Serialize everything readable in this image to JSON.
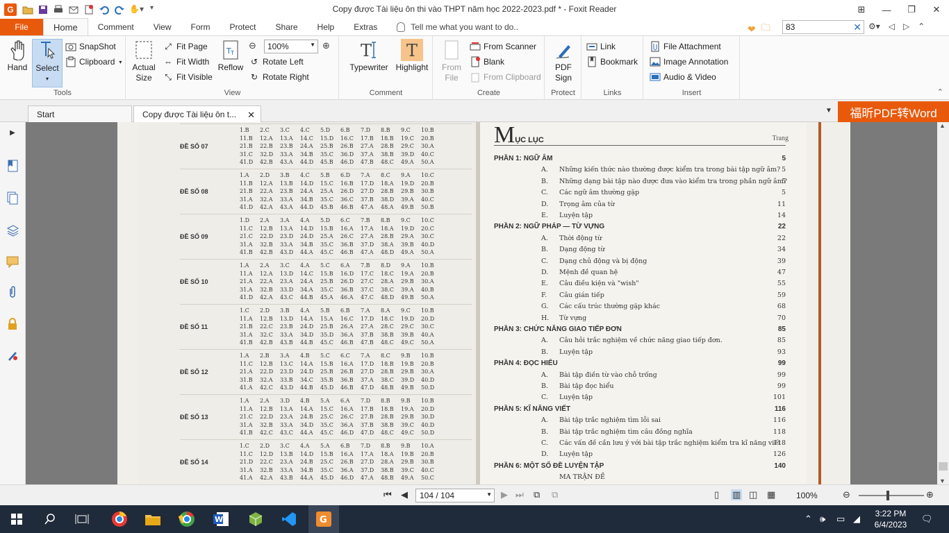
{
  "window": {
    "title": "Copy được Tài liệu ôn thi vào THPT năm học 2022-2023.pdf * - Foxit Reader",
    "app_logo": "G"
  },
  "ribbon_tabs": [
    "File",
    "Home",
    "Comment",
    "View",
    "Form",
    "Protect",
    "Share",
    "Help",
    "Extras"
  ],
  "active_tab": "Home",
  "tell_me": "Tell me what you want to do..",
  "search": {
    "value": "83"
  },
  "tools_group": {
    "label": "Tools",
    "hand": "Hand",
    "select": "Select",
    "snapshot": "SnapShot",
    "clipboard": "Clipboard"
  },
  "view_group": {
    "label": "View",
    "actual_size_1": "Actual",
    "actual_size_2": "Size",
    "fit_page": "Fit Page",
    "fit_width": "Fit Width",
    "fit_visible": "Fit Visible",
    "reflow": "Reflow",
    "zoom": "100%",
    "rotate_left": "Rotate Left",
    "rotate_right": "Rotate Right"
  },
  "comment_group": {
    "label": "Comment",
    "typewriter": "Typewriter",
    "highlight": "Highlight"
  },
  "create_group": {
    "label": "Create",
    "from_file_1": "From",
    "from_file_2": "File",
    "from_scanner": "From Scanner",
    "blank": "Blank",
    "from_clipboard": "From Clipboard"
  },
  "protect_group": {
    "label": "Protect",
    "pdf_sign_1": "PDF",
    "pdf_sign_2": "Sign"
  },
  "links_group": {
    "label": "Links",
    "link": "Link",
    "bookmark": "Bookmark"
  },
  "insert_group": {
    "label": "Insert",
    "file_attachment": "File Attachment",
    "image_annotation": "Image Annotation",
    "audio_video": "Audio & Video"
  },
  "doc_tabs": {
    "start": "Start",
    "current": "Copy được Tài liệu ôn t..."
  },
  "promo": "福昕PDF转Word",
  "answer_key": [
    {
      "label": "ĐỀ SỐ 07",
      "cols": [
        [
          "1.B",
          "11.B",
          "21.B",
          "31.C",
          "41.D"
        ],
        [
          "2.C",
          "12.A",
          "22.B",
          "32.D",
          "42.B"
        ],
        [
          "3.C",
          "13.A",
          "23.B",
          "33.A",
          "43.A"
        ],
        [
          "4.C",
          "14.C",
          "24.A",
          "34.B",
          "44.D"
        ],
        [
          "5.D",
          "15.D",
          "25.B",
          "35.C",
          "45.B"
        ],
        [
          "6.B",
          "16.C",
          "26.B",
          "36.D",
          "46.D"
        ],
        [
          "7.D",
          "17.B",
          "27.A",
          "37.A",
          "47.B"
        ],
        [
          "8.B",
          "18.B",
          "28.B",
          "38.B",
          "48.C"
        ],
        [
          "9.C",
          "19.C",
          "29.C",
          "39.D",
          "49.A"
        ],
        [
          "10.B",
          "20.B",
          "30.A",
          "40.C",
          "50.A"
        ]
      ]
    },
    {
      "label": "ĐỀ SỐ 08",
      "cols": [
        [
          "1.A",
          "11.B",
          "21.B",
          "31.A",
          "41.D"
        ],
        [
          "2.D",
          "12.A",
          "22.A",
          "32.A",
          "42.A"
        ],
        [
          "3.B",
          "13.B",
          "23.B",
          "33.A",
          "43.A"
        ],
        [
          "4.C",
          "14.D",
          "24.A",
          "34.B",
          "44.D"
        ],
        [
          "5.B",
          "15.C",
          "25.A",
          "35.C",
          "45.B"
        ],
        [
          "6.D",
          "16.B",
          "26.D",
          "36.C",
          "46.B"
        ],
        [
          "7.A",
          "17.D",
          "27.D",
          "37.B",
          "47.A"
        ],
        [
          "8.C",
          "18.A",
          "28.B",
          "38.D",
          "48.A"
        ],
        [
          "9.A",
          "19.D",
          "29.B",
          "39.A",
          "49.B"
        ],
        [
          "10.C",
          "20.B",
          "30.B",
          "40.C",
          "50.B"
        ]
      ]
    },
    {
      "label": "ĐỀ SỐ 09",
      "cols": [
        [
          "1.D",
          "11.C",
          "21.C",
          "31.A",
          "41.B"
        ],
        [
          "2.A",
          "12.B",
          "22.D",
          "32.B",
          "42.B"
        ],
        [
          "3.A",
          "13.A",
          "23.D",
          "33.A",
          "43.D"
        ],
        [
          "4.A",
          "14.D",
          "24.D",
          "34.B",
          "44.A"
        ],
        [
          "5.D",
          "15.B",
          "25.A",
          "35.C",
          "45.C"
        ],
        [
          "6.C",
          "16.A",
          "26.C",
          "36.B",
          "46.B"
        ],
        [
          "7.B",
          "17.A",
          "27.A",
          "37.D",
          "47.A"
        ],
        [
          "8.B",
          "18.A",
          "28.B",
          "38.A",
          "48.D"
        ],
        [
          "9.C",
          "19.D",
          "29.A",
          "39.B",
          "49.A"
        ],
        [
          "10.C",
          "20.C",
          "30.C",
          "40.D",
          "50.A"
        ]
      ]
    },
    {
      "label": "ĐỀ SỐ 10",
      "cols": [
        [
          "1.A",
          "11.A",
          "21.A",
          "31.A",
          "41.D"
        ],
        [
          "2.A",
          "12.A",
          "22.A",
          "32.B",
          "42.A"
        ],
        [
          "3.C",
          "13.D",
          "23.A",
          "33.D",
          "43.C"
        ],
        [
          "4.A",
          "14.C",
          "24.A",
          "34.A",
          "44.B"
        ],
        [
          "5.C",
          "15.B",
          "25.B",
          "35.C",
          "45.A"
        ],
        [
          "6.A",
          "16.D",
          "26.D",
          "36.B",
          "46.A"
        ],
        [
          "7.B",
          "17.C",
          "27.C",
          "37.C",
          "47.C"
        ],
        [
          "8.D",
          "18.C",
          "28.A",
          "38.C",
          "48.D"
        ],
        [
          "9.A",
          "19.A",
          "29.B",
          "39.A",
          "49.B"
        ],
        [
          "10.B",
          "20.B",
          "30.A",
          "40.B",
          "50.A"
        ]
      ]
    },
    {
      "label": "ĐỀ SỐ 11",
      "cols": [
        [
          "1.C",
          "11.A",
          "21.B",
          "31.A",
          "41.B"
        ],
        [
          "2.D",
          "12.B",
          "22.C",
          "32.C",
          "42.B"
        ],
        [
          "3.B",
          "13.D",
          "23.B",
          "33.A",
          "43.B"
        ],
        [
          "4.A",
          "14.A",
          "24.D",
          "34.D",
          "44.B"
        ],
        [
          "5.B",
          "15.A",
          "25.B",
          "35.D",
          "45.C"
        ],
        [
          "6.B",
          "16.C",
          "26.A",
          "36.A",
          "46.B"
        ],
        [
          "7.A",
          "17.D",
          "27.A",
          "37.B",
          "47.B"
        ],
        [
          "8.A",
          "18.C",
          "28.C",
          "38.B",
          "48.C"
        ],
        [
          "9.C",
          "19.D",
          "29.C",
          "39.B",
          "49.C"
        ],
        [
          "10.B",
          "20.D",
          "30.C",
          "40.A",
          "50.A"
        ]
      ]
    },
    {
      "label": "ĐỀ SỐ 12",
      "cols": [
        [
          "1.A",
          "11.C",
          "21.A",
          "31.B",
          "41.A"
        ],
        [
          "2.B",
          "12.B",
          "22.D",
          "32.A",
          "42.C"
        ],
        [
          "3.A",
          "13.C",
          "23.D",
          "33.B",
          "43.D"
        ],
        [
          "4.B",
          "14.A",
          "24.D",
          "34.C",
          "44.B"
        ],
        [
          "5.C",
          "15.B",
          "25.B",
          "35.B",
          "45.D"
        ],
        [
          "6.C",
          "16.A",
          "26.B",
          "36.B",
          "46.B"
        ],
        [
          "7.A",
          "17.D",
          "27.D",
          "37.A",
          "47.D"
        ],
        [
          "8.C",
          "18.B",
          "28.B",
          "38.C",
          "48.B"
        ],
        [
          "9.B",
          "19.B",
          "29.B",
          "39.D",
          "49.B"
        ],
        [
          "10.B",
          "20.B",
          "30.A",
          "40.D",
          "50.D"
        ]
      ]
    },
    {
      "label": "ĐỀ SỐ 13",
      "cols": [
        [
          "1.A",
          "11.A",
          "21.C",
          "31.A",
          "41.B"
        ],
        [
          "2.A",
          "12.B",
          "22.D",
          "32.B",
          "42.C"
        ],
        [
          "3.D",
          "13.A",
          "23.A",
          "33.A",
          "43.C"
        ],
        [
          "4.B",
          "14.A",
          "24.B",
          "34.D",
          "44.A"
        ],
        [
          "5.A",
          "15.C",
          "25.C",
          "35.C",
          "45.C"
        ],
        [
          "6.A",
          "16.A",
          "26.C",
          "36.A",
          "46.D"
        ],
        [
          "7.D",
          "17.B",
          "27.B",
          "37.B",
          "47.D"
        ],
        [
          "8.B",
          "18.B",
          "28.B",
          "38.B",
          "48.C"
        ],
        [
          "9.B",
          "19.A",
          "29.B",
          "39.C",
          "49.C"
        ],
        [
          "10.B",
          "20.D",
          "30.D",
          "40.D",
          "50.D"
        ]
      ]
    },
    {
      "label": "ĐỀ SỐ 14",
      "cols": [
        [
          "1.C",
          "11.C",
          "21.D",
          "31.A",
          "41.A"
        ],
        [
          "2.D",
          "12.D",
          "22.C",
          "32.B",
          "42.A"
        ],
        [
          "3.C",
          "13.B",
          "23.A",
          "33.A",
          "43.B"
        ],
        [
          "4.A",
          "14.D",
          "24.B",
          "34.B",
          "44.A"
        ],
        [
          "5.A",
          "15.B",
          "25.C",
          "35.C",
          "45.D"
        ],
        [
          "6.B",
          "16.A",
          "26.B",
          "36.A",
          "46.D"
        ],
        [
          "7.D",
          "17.A",
          "27.D",
          "37.D",
          "47.A"
        ],
        [
          "8.B",
          "18.A",
          "28.A",
          "38.B",
          "48.B"
        ],
        [
          "9.B",
          "19.B",
          "29.B",
          "39.C",
          "49.A"
        ],
        [
          "10.A",
          "20.B",
          "30.B",
          "40.C",
          "50.C"
        ]
      ]
    }
  ],
  "toc": {
    "title_big": "M",
    "title_rest": "ỤC LỤC",
    "trang": "Trang",
    "entries": [
      {
        "part": true,
        "text": "PHẦN 1: NGỮ ÂM",
        "page": "5"
      },
      {
        "ltr": "A.",
        "text": "Những kiến thức nào thường được kiểm tra trong bài tập ngữ âm?",
        "page": "5"
      },
      {
        "ltr": "B.",
        "text": "Những dạng bài tập nào được đưa vào kiểm tra trong phần ngữ âm?",
        "page": "5"
      },
      {
        "ltr": "C.",
        "text": "Các ngữ âm thường gặp",
        "page": "5"
      },
      {
        "ltr": "D.",
        "text": "Trọng âm của từ",
        "page": "11"
      },
      {
        "ltr": "E.",
        "text": "Luyện tập",
        "page": "14"
      },
      {
        "part": true,
        "text": "PHẦN 2: NGỮ PHÁP — TỪ VỰNG",
        "page": "22"
      },
      {
        "ltr": "A.",
        "text": "Thời động từ",
        "page": "22"
      },
      {
        "ltr": "B.",
        "text": "Dạng động từ",
        "page": "34"
      },
      {
        "ltr": "C.",
        "text": "Dạng chủ động và bị động",
        "page": "39"
      },
      {
        "ltr": "D.",
        "text": "Mệnh đề quan hệ",
        "page": "47"
      },
      {
        "ltr": "E.",
        "text": "Câu điều kiện và \"wish\"",
        "page": "55"
      },
      {
        "ltr": "F.",
        "text": "Câu gián tiếp",
        "page": "59"
      },
      {
        "ltr": "G.",
        "text": "Các cấu trúc thường gặp khác",
        "page": "68"
      },
      {
        "ltr": "H.",
        "text": "Từ vựng",
        "page": "70"
      },
      {
        "part": true,
        "text": "PHẦN 3: CHỨC NĂNG GIAO TIẾP ĐƠN",
        "page": "85"
      },
      {
        "ltr": "A.",
        "text": "Câu hỏi trắc nghiệm về chức năng giao tiếp đơn.",
        "page": "85"
      },
      {
        "ltr": "B.",
        "text": "Luyện tập",
        "page": "93"
      },
      {
        "part": true,
        "text": "PHẦN 4: ĐỌC HIỂU",
        "page": "99"
      },
      {
        "ltr": "A.",
        "text": "Bài tập điền từ vào chỗ trống",
        "page": "99"
      },
      {
        "ltr": "B.",
        "text": "Bài tập đọc hiểu",
        "page": "99"
      },
      {
        "ltr": "C.",
        "text": "Luyện tập",
        "page": "101"
      },
      {
        "part": true,
        "text": "PHẦN 5: KĨ NĂNG VIẾT",
        "page": "116"
      },
      {
        "ltr": "A.",
        "text": "Bài tập trắc nghiệm tìm lỗi sai",
        "page": "116"
      },
      {
        "ltr": "B.",
        "text": "Bài tập trắc nghiệm tìm câu đồng nghĩa",
        "page": "118"
      },
      {
        "ltr": "C.",
        "text": "Các vấn đề cần lưu ý với bài tập trắc nghiệm kiểm tra kĩ năng viết",
        "page": "118"
      },
      {
        "ltr": "D.",
        "text": "Luyện tập",
        "page": "126"
      },
      {
        "part": true,
        "text": "PHẦN 6: MỘT SỐ ĐỀ LUYỆN TẬP",
        "page": "140"
      },
      {
        "ltr": "",
        "text": "MA TRẬN ĐỀ",
        "page": ""
      }
    ]
  },
  "status": {
    "page": "104 / 104",
    "zoom": "100%",
    "zoom_level_percent": 45
  },
  "clock": {
    "time": "3:22 PM",
    "date": "6/4/2023"
  }
}
